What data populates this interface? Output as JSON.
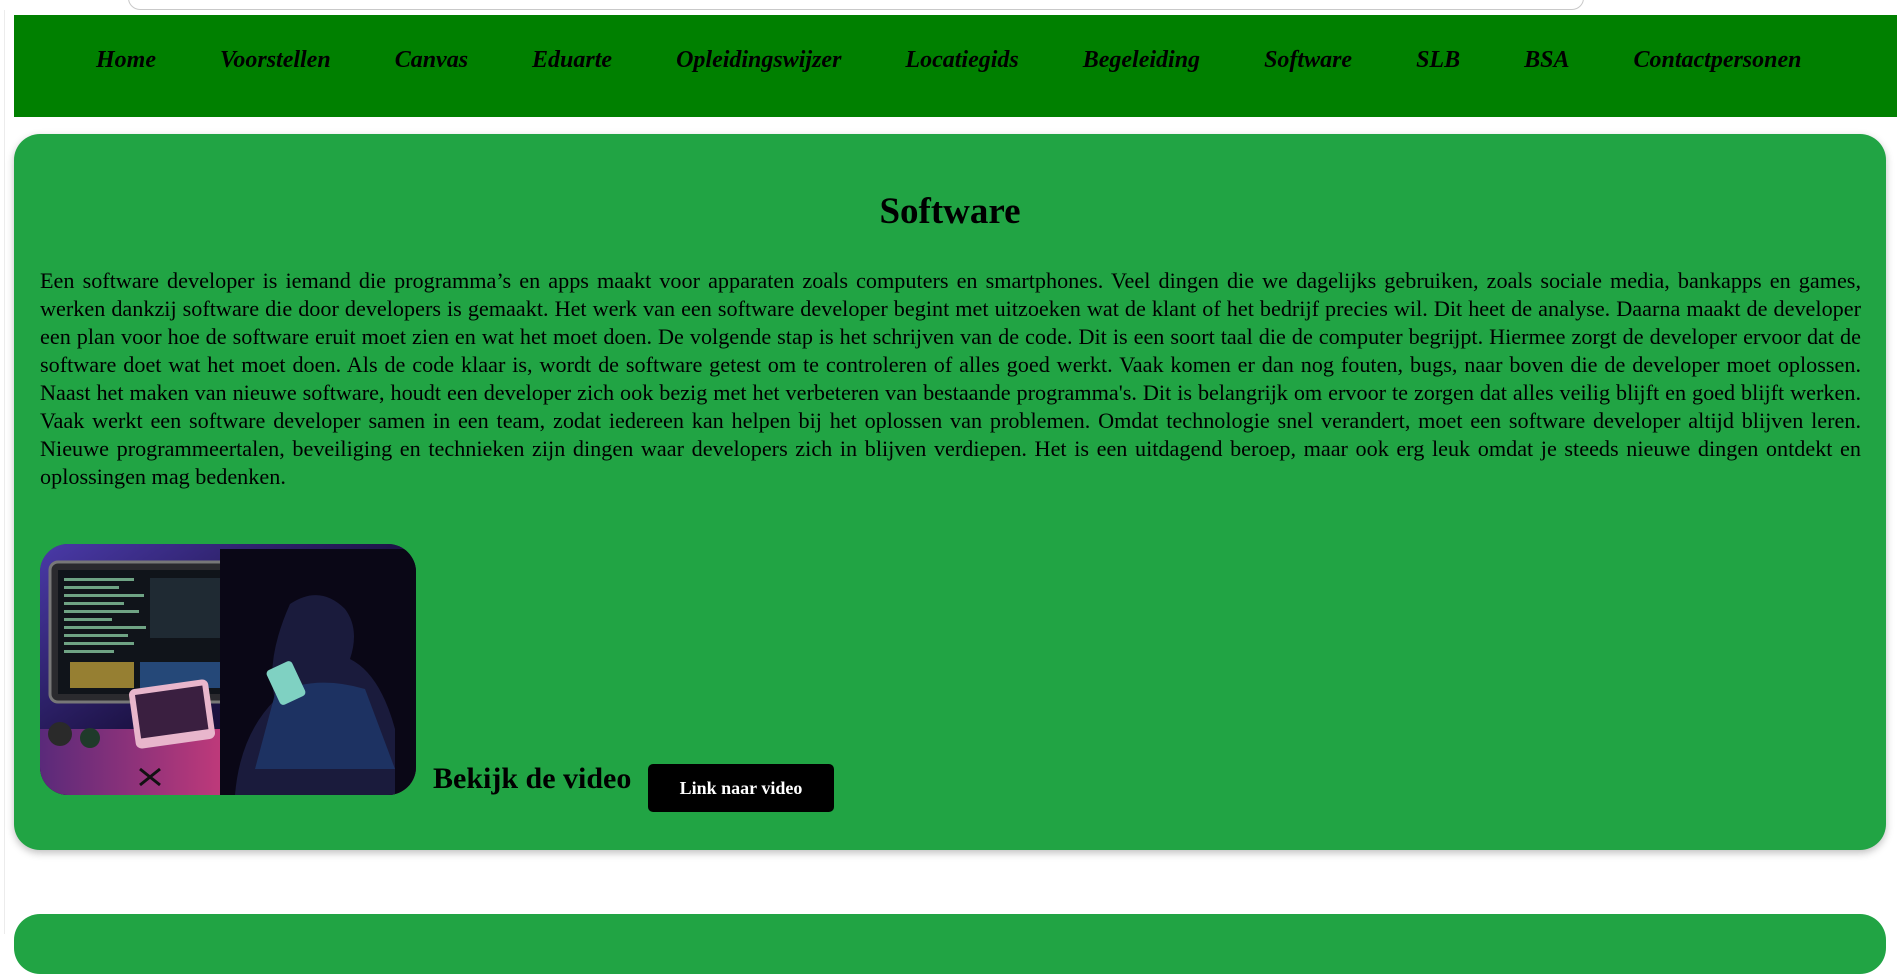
{
  "nav": {
    "items": [
      {
        "label": "Home"
      },
      {
        "label": "Voorstellen"
      },
      {
        "label": "Canvas"
      },
      {
        "label": "Eduarte"
      },
      {
        "label": "Opleidingswijzer"
      },
      {
        "label": "Locatiegids"
      },
      {
        "label": "Begeleiding"
      },
      {
        "label": "Software"
      },
      {
        "label": "SLB"
      },
      {
        "label": "BSA"
      },
      {
        "label": "Contactpersonen"
      }
    ]
  },
  "section": {
    "title": "Software",
    "body": "Een software developer is iemand die programma’s en apps maakt voor apparaten zoals computers en smartphones. Veel dingen die we dagelijks gebruiken, zoals sociale media, bankapps en games, werken dankzij software die door developers is gemaakt. Het werk van een software developer begint met uitzoeken wat de klant of het bedrijf precies wil. Dit heet de analyse. Daarna maakt de developer een plan voor hoe de software eruit moet zien en wat het moet doen. De volgende stap is het schrijven van de code. Dit is een soort taal die de computer begrijpt. Hiermee zorgt de developer ervoor dat de software doet wat het moet doen. Als de code klaar is, wordt de software getest om te controleren of alles goed werkt. Vaak komen er dan nog fouten, bugs, naar boven die de developer moet oplossen. Naast het maken van nieuwe software, houdt een developer zich ook bezig met het verbeteren van bestaande programma's. Dit is belangrijk om ervoor te zorgen dat alles veilig blijft en goed blijft werken. Vaak werkt een software developer samen in een team, zodat iedereen kan helpen bij het oplossen van problemen. Omdat technologie snel verandert, moet een software developer altijd blijven leren. Nieuwe programmeertalen, beveiliging en technieken zijn dingen waar developers zich in blijven verdiepen. Het is een uitdagend beroep, maar ook erg leuk omdat je steeds nieuwe dingen ontdekt en oplossingen mag bedenken.",
    "video_label": "Bekijk de video",
    "video_button": "Link naar video"
  },
  "colors": {
    "nav_bg": "#008000",
    "card_bg": "#21a444",
    "button_bg": "#000000",
    "button_text": "#ffffff"
  }
}
